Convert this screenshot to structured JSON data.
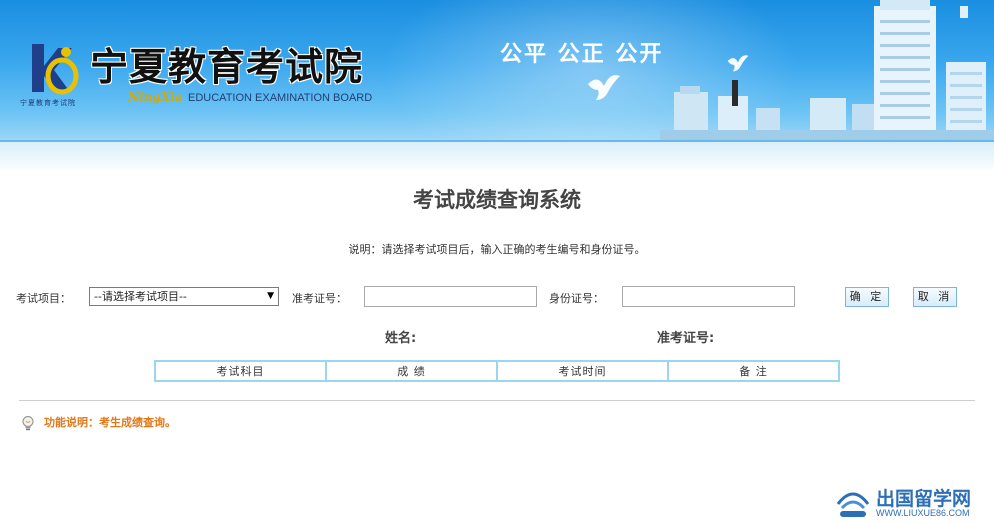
{
  "header": {
    "logo_small_text": "宁夏教育考试院",
    "site_title": "宁夏教育考试院",
    "ningxia_text": "NingXia",
    "english_name": "EDUCATION EXAMINATION BOARD",
    "slogan": "公平 公正 公开"
  },
  "main": {
    "page_title": "考试成绩查询系统",
    "instruction": "说明：请选择考试项目后，输入正确的考生编号和身份证号。"
  },
  "form": {
    "exam_item_label": "考试项目：",
    "exam_item_selected": "--请选择考试项目--",
    "admission_label": "准考证号：",
    "admission_value": "",
    "id_label": "身份证号：",
    "id_value": "",
    "confirm_label": "确 定",
    "cancel_label": "取 消"
  },
  "result": {
    "name_label": "姓名:",
    "admission_label": "准考证号:",
    "columns": [
      "考试科目",
      "成 绩",
      "考试时间",
      "备 注"
    ]
  },
  "footer": {
    "function_note": "功能说明：考生成绩查询。"
  },
  "watermark": {
    "cn": "出国留学网",
    "en": "WWW.LIUXUE86.COM"
  },
  "colors": {
    "banner_top": "#1a8ee0",
    "table_border": "#9ad7ee",
    "function_note": "#e0791a",
    "watermark": "#2d6fb7"
  }
}
